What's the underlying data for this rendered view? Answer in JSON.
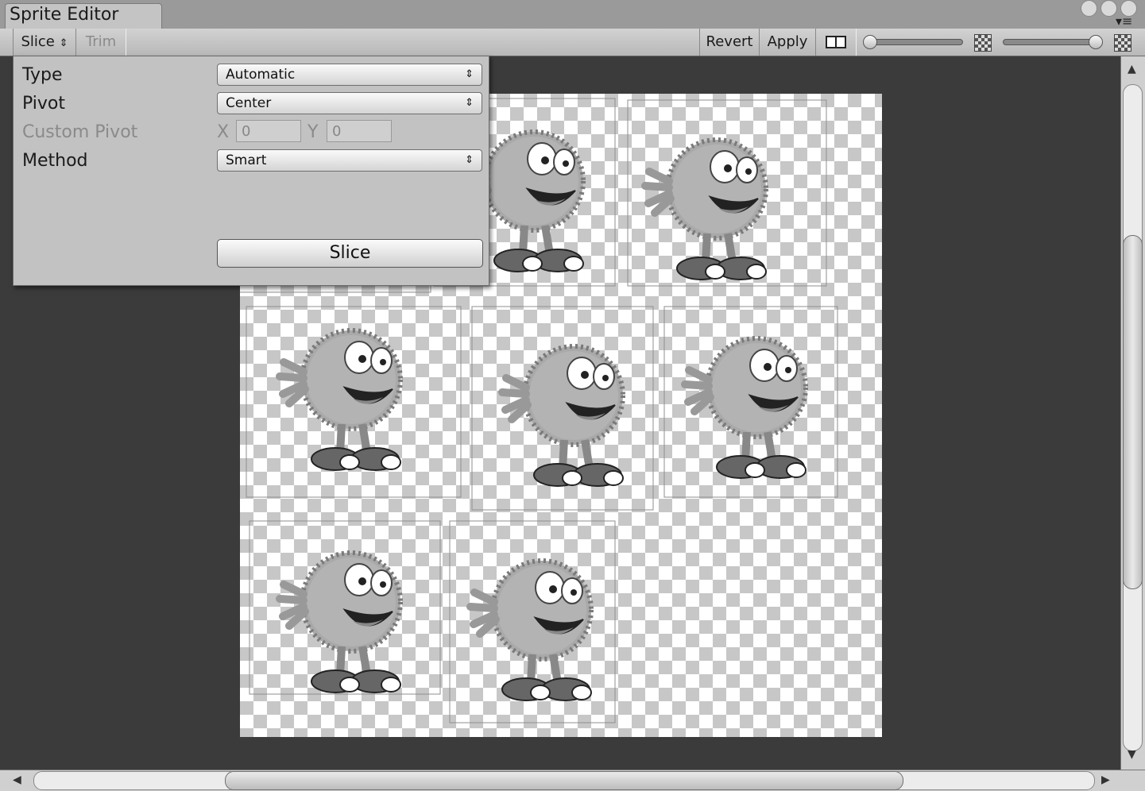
{
  "window": {
    "tab_title": "Sprite Editor",
    "menu_icon": "menu-icon"
  },
  "toolbar": {
    "slice_label": "Slice",
    "slice_arrows": "⇕",
    "trim_label": "Trim",
    "revert_label": "Revert",
    "apply_label": "Apply"
  },
  "slice_panel": {
    "type_label": "Type",
    "type_value": "Automatic",
    "pivot_label": "Pivot",
    "pivot_value": "Center",
    "custom_pivot_label": "Custom Pivot",
    "x_label": "X",
    "x_value": "0",
    "y_label": "Y",
    "y_value": "0",
    "method_label": "Method",
    "method_value": "Smart",
    "slice_button": "Slice"
  },
  "colors": {
    "canvas": "#3b3b3b",
    "panel": "#c2c2c2",
    "checker_dark": "#c7c7c7",
    "checker_light": "#ffffff"
  }
}
